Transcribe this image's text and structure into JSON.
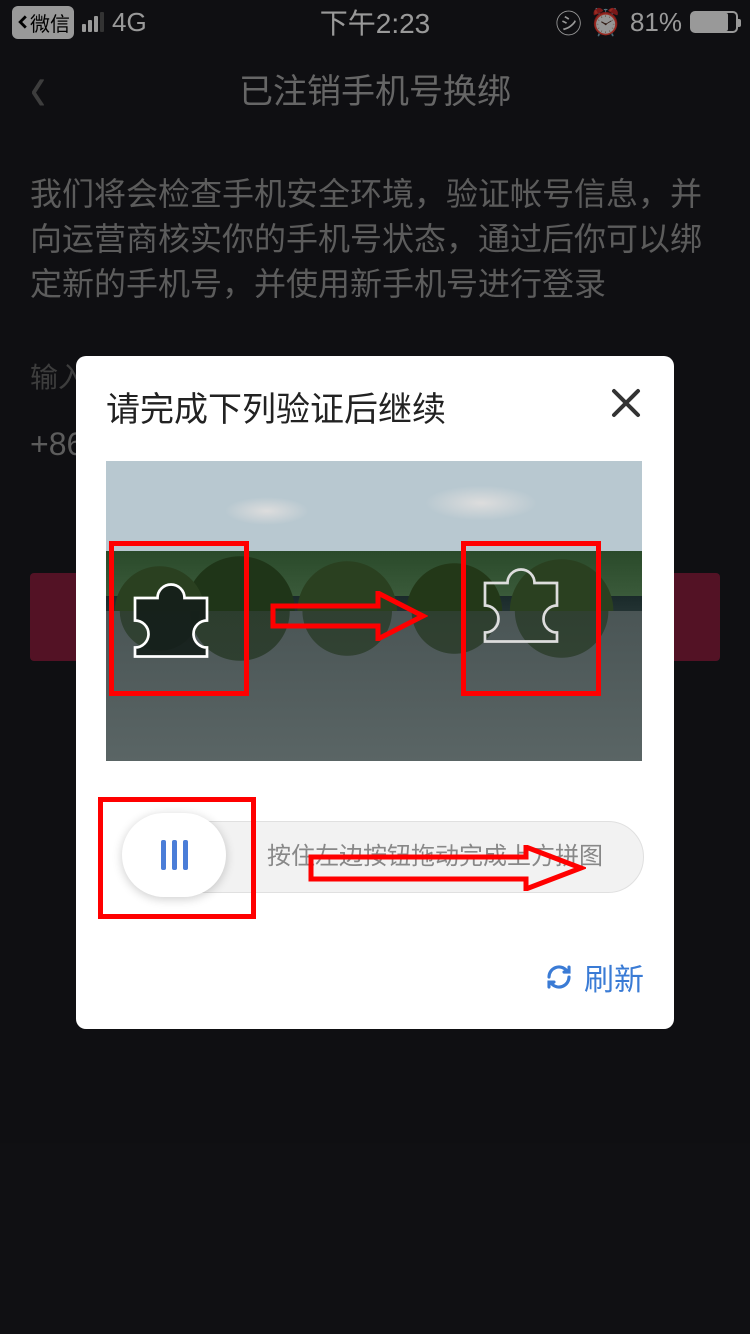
{
  "status": {
    "app_return": "微信",
    "network": "4G",
    "time": "下午2:23",
    "battery_pct": "81%"
  },
  "nav": {
    "title": "已注销手机号换绑"
  },
  "page": {
    "description": "我们将会检查手机安全环境，验证帐号信息，并向运营商核实你的手机号状态，通过后你可以绑定新的手机号，并使用新手机号进行登录",
    "field_label": "输入原手机号",
    "country_code": "+86"
  },
  "captcha": {
    "title": "请完成下列验证后继续",
    "slider_hint": "按住左边按钮拖动完成上方拼图",
    "refresh_label": "刷新"
  }
}
